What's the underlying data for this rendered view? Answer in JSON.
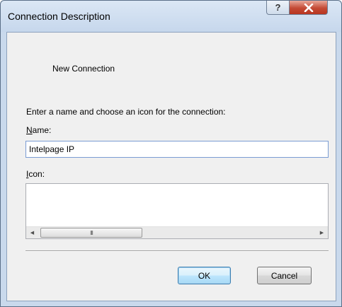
{
  "window": {
    "title": "Connection Description",
    "help_glyph": "?",
    "close_glyph": "X"
  },
  "dialog": {
    "connection_name": "New Connection",
    "instruction": "Enter a name and choose an icon for the connection:",
    "name_label_mnemonic": "N",
    "name_label_rest": "ame:",
    "name_value": "Intelpage IP",
    "icon_label_mnemonic": "I",
    "icon_label_rest": "con:",
    "scroll_left_glyph": "◀",
    "scroll_right_glyph": "▶",
    "scroll_thumb_grip": "III"
  },
  "buttons": {
    "ok_label": "OK",
    "cancel_label": "Cancel"
  },
  "colors": {
    "title_bar": "#c9d9ec",
    "close_button": "#c44a35",
    "default_button_border": "#3c7fb1"
  }
}
